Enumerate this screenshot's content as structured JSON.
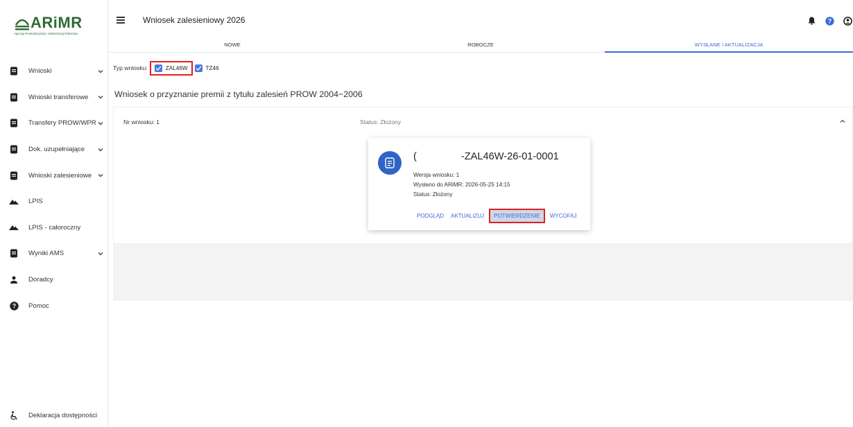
{
  "logo": {
    "brand": "ARiMR",
    "tagline": "Agencja Restrukturyzacji i Modernizacji Rolnictwa"
  },
  "sidebar": {
    "items": [
      {
        "label": "Wnioski",
        "icon": "document-icon",
        "expandable": true
      },
      {
        "label": "Wnioski transferowe",
        "icon": "document-icon",
        "expandable": true
      },
      {
        "label": "Transfery PROW/WPR",
        "icon": "document-icon",
        "expandable": true
      },
      {
        "label": "Dok. uzupełniające",
        "icon": "document-icon",
        "expandable": true
      },
      {
        "label": "Wnioski zalesieniowe",
        "icon": "document-icon",
        "expandable": true
      },
      {
        "label": "LPIS",
        "icon": "mountain-icon",
        "expandable": false
      },
      {
        "label": "LPIS - całoroczny",
        "icon": "mountain-icon",
        "expandable": false
      },
      {
        "label": "Wyniki AMS",
        "icon": "document-icon",
        "expandable": true
      },
      {
        "label": "Doradcy",
        "icon": "person-icon",
        "expandable": false
      },
      {
        "label": "Pomoc",
        "icon": "help-circle-icon",
        "expandable": false
      }
    ],
    "footer": {
      "label": "Deklaracja dostępności",
      "icon": "accessibility-icon"
    }
  },
  "header": {
    "title": "Wniosek zalesieniowy 2026",
    "icons": [
      "bell-icon",
      "help-icon",
      "account-icon"
    ]
  },
  "tabs": [
    {
      "label": "NOWE",
      "active": false
    },
    {
      "label": "ROBOCZE",
      "active": false
    },
    {
      "label": "WYSŁANE / AKTUALIZACJA",
      "active": true
    }
  ],
  "filter": {
    "label": "Typ wniosku:",
    "options": [
      {
        "label": "ZAL46W",
        "checked": true,
        "highlighted": true
      },
      {
        "label": "TZ46",
        "checked": true,
        "highlighted": false
      }
    ]
  },
  "section": {
    "title": "Wniosek o przyznanie premii z tytułu zalesień PROW 2004−2006"
  },
  "panel": {
    "nr_label": "Nr wniosku: 1",
    "status_label": "Status: Złożony"
  },
  "card": {
    "number_prefix": "(",
    "number_suffix": "-ZAL46W-26-01-0001",
    "version": "Wersja wniosku: 1",
    "sent": "Wysłano do ARiMR: 2026-05-25 14:15",
    "status": "Status: Złożony",
    "actions": {
      "preview": "PODGLĄD",
      "update": "AKTUALIZUJ",
      "confirm": "POTWIERDZENIE",
      "withdraw": "WYCOFAJ"
    }
  },
  "colors": {
    "accent": "#3c6bd6",
    "brand_green": "#2e6b34",
    "highlight_red": "#e02020",
    "avatar_blue": "#2f63c6"
  }
}
